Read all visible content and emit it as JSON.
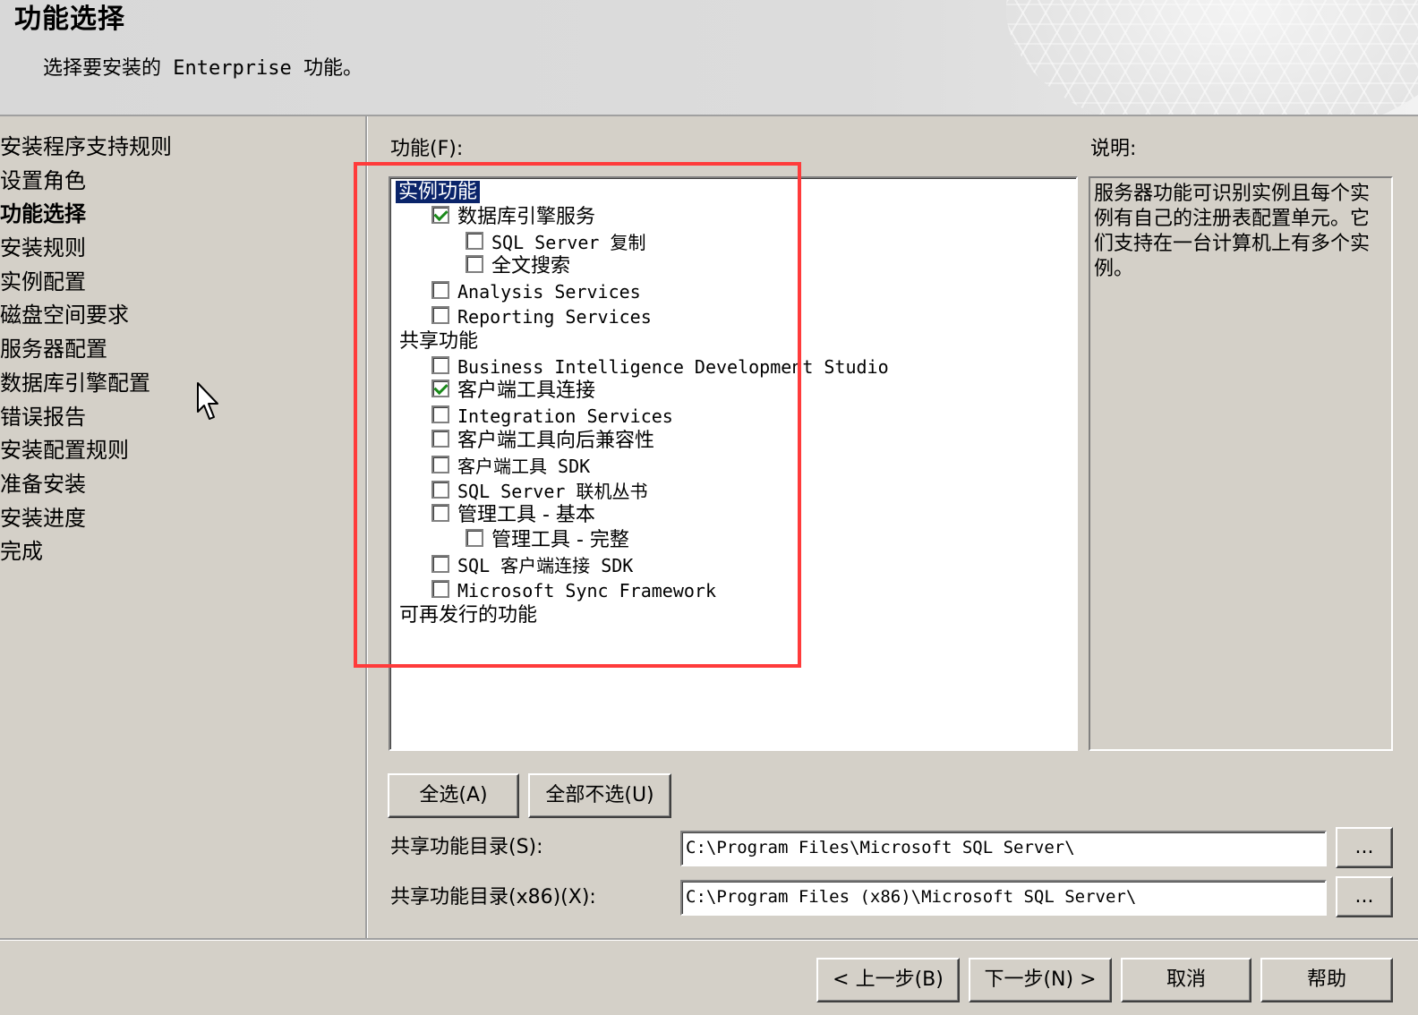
{
  "header": {
    "title": "功能选择",
    "subtitle": "选择要安装的 Enterprise 功能。"
  },
  "nav": {
    "items": [
      {
        "label": "安装程序支持规则",
        "active": false
      },
      {
        "label": "设置角色",
        "active": false
      },
      {
        "label": "功能选择",
        "active": true
      },
      {
        "label": "安装规则",
        "active": false
      },
      {
        "label": "实例配置",
        "active": false
      },
      {
        "label": "磁盘空间要求",
        "active": false
      },
      {
        "label": "服务器配置",
        "active": false
      },
      {
        "label": "数据库引擎配置",
        "active": false
      },
      {
        "label": "错误报告",
        "active": false
      },
      {
        "label": "安装配置规则",
        "active": false
      },
      {
        "label": "准备安装",
        "active": false
      },
      {
        "label": "安装进度",
        "active": false
      },
      {
        "label": "完成",
        "active": false
      }
    ]
  },
  "features": {
    "label": "功能(F):",
    "tree": [
      {
        "type": "group",
        "label": "实例功能",
        "selected": true
      },
      {
        "type": "item",
        "label": "数据库引擎服务",
        "checked": true,
        "level": 1,
        "mono": false
      },
      {
        "type": "item",
        "label": "SQL Server 复制",
        "checked": false,
        "level": 2,
        "mono": true
      },
      {
        "type": "item",
        "label": "全文搜索",
        "checked": false,
        "level": 2,
        "mono": false
      },
      {
        "type": "item",
        "label": "Analysis Services",
        "checked": false,
        "level": 1,
        "mono": true
      },
      {
        "type": "item",
        "label": "Reporting Services",
        "checked": false,
        "level": 1,
        "mono": true
      },
      {
        "type": "group",
        "label": "共享功能",
        "selected": false
      },
      {
        "type": "item",
        "label": "Business Intelligence Development Studio",
        "checked": false,
        "level": 1,
        "mono": true
      },
      {
        "type": "item",
        "label": "客户端工具连接",
        "checked": true,
        "level": 1,
        "mono": false
      },
      {
        "type": "item",
        "label": "Integration Services",
        "checked": false,
        "level": 1,
        "mono": true
      },
      {
        "type": "item",
        "label": "客户端工具向后兼容性",
        "checked": false,
        "level": 1,
        "mono": false
      },
      {
        "type": "item",
        "label": "客户端工具 SDK",
        "checked": false,
        "level": 1,
        "mono": true
      },
      {
        "type": "item",
        "label": "SQL Server 联机丛书",
        "checked": false,
        "level": 1,
        "mono": true
      },
      {
        "type": "item",
        "label": "管理工具 - 基本",
        "checked": false,
        "level": 1,
        "mono": false
      },
      {
        "type": "item",
        "label": "管理工具 - 完整",
        "checked": false,
        "level": 2,
        "mono": false
      },
      {
        "type": "item",
        "label": "SQL 客户端连接 SDK",
        "checked": false,
        "level": 1,
        "mono": true
      },
      {
        "type": "item",
        "label": "Microsoft Sync Framework",
        "checked": false,
        "level": 1,
        "mono": true
      },
      {
        "type": "group",
        "label": "可再发行的功能",
        "selected": false
      }
    ]
  },
  "description": {
    "label": "说明:",
    "text": "服务器功能可识别实例且每个实例有自己的注册表配置单元。它们支持在一台计算机上有多个实例。"
  },
  "buttons": {
    "select_all": "全选(A)",
    "deselect_all": "全部不选(U)",
    "browse": "...",
    "back": "< 上一步(B)",
    "next": "下一步(N) >",
    "cancel": "取消",
    "help": "帮助"
  },
  "shared_dir": {
    "label": "共享功能目录(S):",
    "value": "C:\\Program Files\\Microsoft SQL Server\\"
  },
  "shared_dir_x86": {
    "label": "共享功能目录(x86)(X):",
    "value": "C:\\Program Files (x86)\\Microsoft SQL Server\\"
  },
  "colors": {
    "highlight_border": "#ff3b3b",
    "selection_bg": "#0a246a",
    "check_color": "#1a8a1a"
  }
}
